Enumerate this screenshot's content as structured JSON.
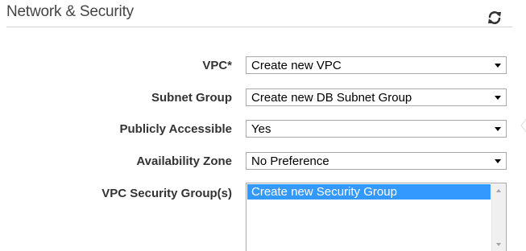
{
  "section": {
    "title": "Network & Security",
    "refresh_icon": "refresh-icon"
  },
  "fields": {
    "vpc": {
      "label": "VPC*",
      "value": "Create new VPC"
    },
    "subnet_group": {
      "label": "Subnet Group",
      "value": "Create new DB Subnet Group"
    },
    "publicly_accessible": {
      "label": "Publicly Accessible",
      "value": "Yes"
    },
    "availability_zone": {
      "label": "Availability Zone",
      "value": "No Preference"
    },
    "vpc_security_groups": {
      "label": "VPC Security Group(s)",
      "options": [
        "Create new Security Group"
      ],
      "selected": "Create new Security Group"
    }
  },
  "colors": {
    "selection": "#3399ff",
    "label": "#333333",
    "title": "#444444",
    "border": "#a9a9a9"
  }
}
